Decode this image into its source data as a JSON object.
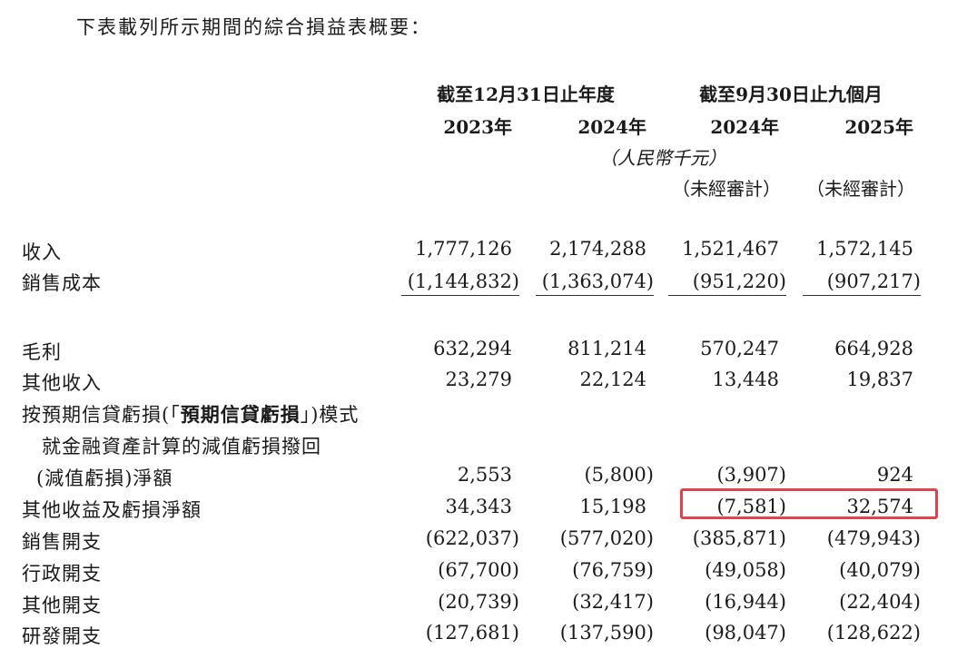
{
  "intro": "下表載列所示期間的綜合損益表概要：",
  "header": {
    "group_annual": "截至12月31日止年度",
    "group_nine": "截至9月30日止九個月",
    "years": [
      "2023年",
      "2024年",
      "2024年",
      "2025年"
    ],
    "unit": "（人民幣千元）",
    "unaudited": [
      "（未經審計）",
      "（未經審計）"
    ]
  },
  "rows": [
    {
      "label": "收入",
      "values": [
        "1,777,126",
        "2,174,288",
        "1,521,467",
        "1,572,145"
      ]
    },
    {
      "label": "銷售成本",
      "values": [
        "(1,144,832)",
        "(1,363,074)",
        "(951,220)",
        "(907,217)"
      ]
    },
    {
      "label": "毛利",
      "values": [
        "632,294",
        "811,214",
        "570,247",
        "664,928"
      ]
    },
    {
      "label": "其他收入",
      "values": [
        "23,279",
        "22,124",
        "13,448",
        "19,837"
      ]
    },
    {
      "label_parts": [
        "按預期信貸虧損(「",
        "預期信貸虧損",
        "」)模式"
      ],
      "label_line2": "就金融資產計算的減值虧損撥回",
      "label_line3": "(減值虧損)淨額",
      "values": [
        "2,553",
        "(5,800)",
        "(3,907)",
        "924"
      ]
    },
    {
      "label": "其他收益及虧損淨額",
      "values": [
        "34,343",
        "15,198",
        "(7,581)",
        "32,574"
      ]
    },
    {
      "label": "銷售開支",
      "values": [
        "(622,037)",
        "(577,020)",
        "(385,871)",
        "(479,943)"
      ]
    },
    {
      "label": "行政開支",
      "values": [
        "(67,700)",
        "(76,759)",
        "(49,058)",
        "(40,079)"
      ]
    },
    {
      "label": "其他開支",
      "values": [
        "(20,739)",
        "(32,417)",
        "(16,944)",
        "(22,404)"
      ]
    },
    {
      "label": "研發開支",
      "values": [
        "(127,681)",
        "(137,590)",
        "(98,047)",
        "(128,622)"
      ]
    }
  ],
  "highlight_color": "#e0434b"
}
